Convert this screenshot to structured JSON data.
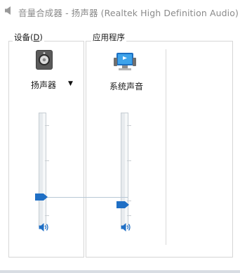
{
  "window": {
    "title": "音量合成器 - 扬声器 (Realtek High Definition Audio)"
  },
  "device": {
    "group_label_prefix": "设备(",
    "group_label_accel": "D",
    "group_label_suffix": ")",
    "name": "扬声器",
    "volume_percent": 25
  },
  "applications": {
    "group_label": "应用程序",
    "items": [
      {
        "name": "系统声音",
        "volume_percent": 18
      }
    ]
  },
  "icons": {
    "title": "speaker-icon",
    "device": "speaker-device-icon",
    "app": "system-sounds-icon",
    "mute": "volume-icon"
  },
  "colors": {
    "accent": "#1f6fc5",
    "title_text": "#8a8a8a"
  }
}
